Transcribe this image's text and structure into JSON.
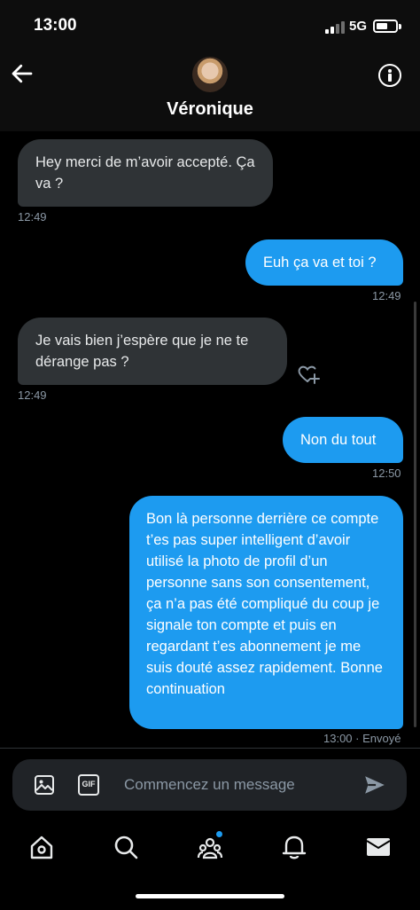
{
  "status_bar": {
    "time": "13:00",
    "network": "5G"
  },
  "header": {
    "contact_name": "Véronique",
    "back_icon": "back-arrow-icon",
    "info_icon": "info-icon"
  },
  "messages": [
    {
      "direction": "in",
      "text": "Hey merci de m’avoir accepté. Ça va ?",
      "time": "12:49"
    },
    {
      "direction": "out",
      "text": "Euh ça va et toi ?",
      "time": "12:49"
    },
    {
      "direction": "in",
      "text": "Je vais bien j’espère que je ne te dérange pas ?",
      "time": "12:49"
    },
    {
      "direction": "out",
      "text": "Non du tout",
      "time": "12:50"
    },
    {
      "direction": "out",
      "text": "Bon là personne derrière ce compte t’es pas super intelligent d’avoir utilisé la photo de profil d’un personne sans son consentement, ça n’a pas été compliqué du coup je signale ton compte et puis en regardant t’es abonnement je me suis douté assez rapidement. Bonne continuation",
      "time": "13:00 · Envoyé"
    }
  ],
  "composer": {
    "placeholder": "Commencez un message",
    "gif_label": "GIF"
  },
  "nav": [
    "home-icon",
    "search-icon",
    "communities-icon",
    "notifications-icon",
    "messages-icon"
  ],
  "colors": {
    "accent": "#1d9bf0",
    "incoming_bubble": "#2f3336",
    "background": "#000000"
  }
}
